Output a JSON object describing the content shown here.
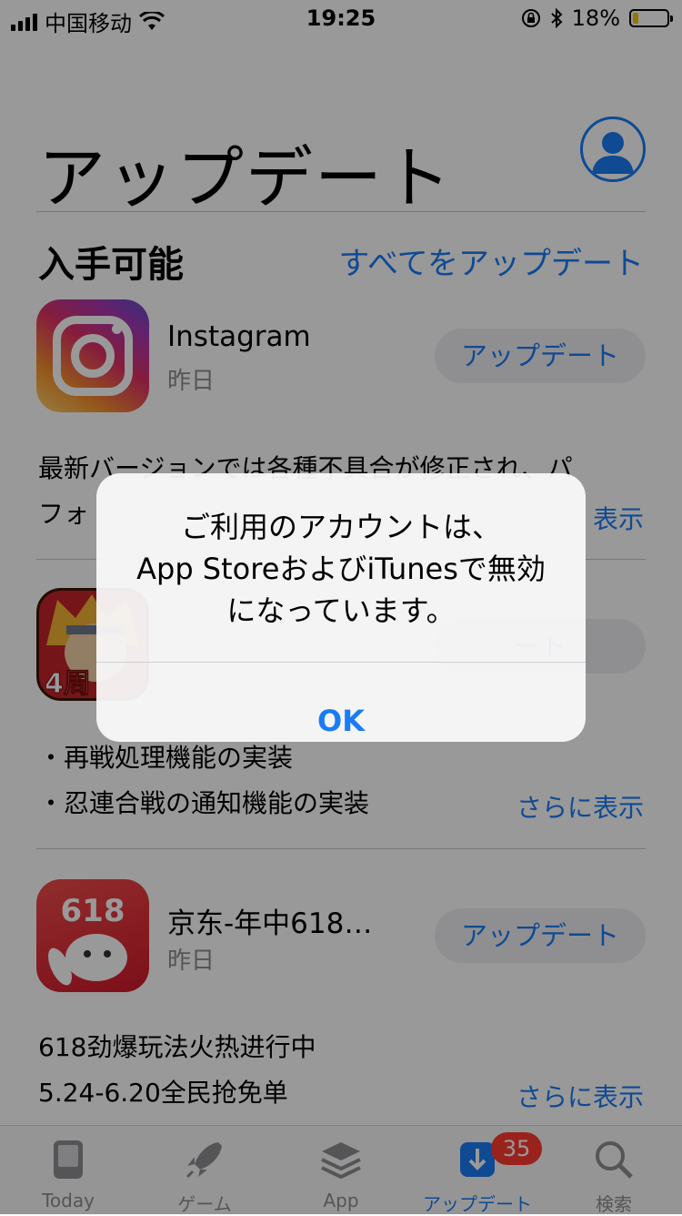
{
  "status_bar": {
    "carrier": "中国移动",
    "time": "19:25",
    "battery_percent": "18%",
    "battery_level": 0.18,
    "icons": [
      "signal-icon",
      "wifi-icon",
      "orientation-lock-icon",
      "bluetooth-icon",
      "battery-icon"
    ]
  },
  "header": {
    "title": "アップデート",
    "account_icon": "person-circle-icon"
  },
  "section": {
    "title": "入手可能",
    "update_all": "すべてをアップデート"
  },
  "apps": [
    {
      "name": "Instagram",
      "date": "昨日",
      "button": "アップデート",
      "notes": [
        "最新バージョンでは各種不具合が修正され、パ",
        "フォ"
      ],
      "more": "表示",
      "icon": "instagram-icon"
    },
    {
      "name": "",
      "date": "",
      "button": "ート",
      "notes": [
        "・再戦処理機能の実装",
        "・忍連合戦の通知機能の実装"
      ],
      "more": "さらに表示",
      "icon_text": "4周",
      "icon": "naruto-game-icon"
    },
    {
      "name": "京东-年中618…",
      "date": "昨日",
      "button": "アップデート",
      "notes": [
        "618劲爆玩法火热进行中",
        "5.24-6.20全民抢免单"
      ],
      "more": "さらに表示",
      "icon_text": "618",
      "icon": "jd-icon"
    }
  ],
  "alert": {
    "message_lines": [
      "ご利用のアカウントは、",
      "App StoreおよびiTunesで無効",
      "になっています。"
    ],
    "ok_label": "OK"
  },
  "tab_bar": {
    "tabs": [
      {
        "label": "Today",
        "icon": "today-icon"
      },
      {
        "label": "ゲーム",
        "icon": "rocket-icon"
      },
      {
        "label": "App",
        "icon": "stack-icon"
      },
      {
        "label": "アップデート",
        "icon": "download-icon",
        "active": true
      },
      {
        "label": "検索",
        "icon": "search-icon"
      }
    ],
    "updates_badge": "35"
  },
  "colors": {
    "accent": "#1a7cf5",
    "badge": "#ff3b30",
    "overlay": "rgba(0,0,0,0.40)"
  }
}
